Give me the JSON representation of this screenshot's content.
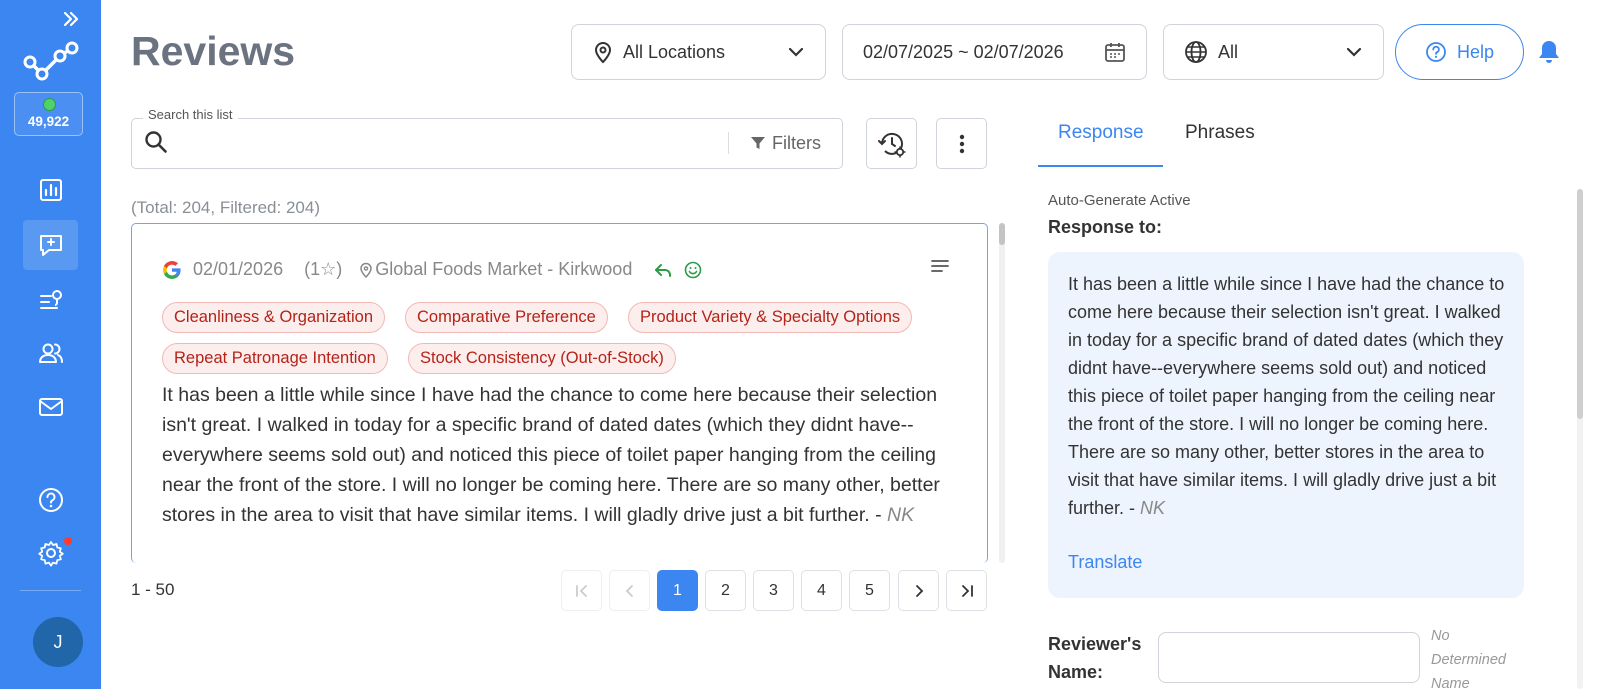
{
  "sidebar": {
    "credits": "49,922",
    "avatar_initial": "J",
    "items": [
      "dashboard-icon",
      "reviews-icon",
      "journey-icon",
      "users-icon",
      "mail-icon",
      "help-icon",
      "settings-icon"
    ]
  },
  "header": {
    "title": "Reviews",
    "location_select": "All Locations",
    "date_range": "02/07/2025 ~ 02/07/2026",
    "language_select": "All",
    "help_label": "Help"
  },
  "search": {
    "label": "Search this list",
    "value": "",
    "filters_label": "Filters"
  },
  "totals": "(Total: 204, Filtered: 204)",
  "review": {
    "date": "02/01/2026",
    "rating": "(1☆)",
    "location": "Global Foods Market - Kirkwood",
    "tags": [
      "Cleanliness & Organization",
      "Comparative Preference",
      "Product Variety & Specialty Options",
      "Repeat Patronage Intention",
      "Stock Consistency (Out-of-Stock)"
    ],
    "text": "It has been a little while since I have had the chance to come here because their selection isn't great. I walked in today for a specific brand of dated dates (which they didnt have--everywhere seems sold out) and noticed this piece of toilet paper hanging from the ceiling near the front of the store. I will no longer be coming here. There are so many other, better stores in the area to visit that have similar items. I will gladly drive just a bit further. - ",
    "author": "NK"
  },
  "pagination": {
    "range": "1 - 50",
    "pages": [
      "1",
      "2",
      "3",
      "4",
      "5"
    ],
    "current": "1"
  },
  "right_panel": {
    "tabs": [
      "Response",
      "Phrases"
    ],
    "active_tab": "Response",
    "auto_generate": "Auto-Generate Active",
    "response_to": "Response to:",
    "response_text": "It has been a little while since I have had the chance to come here because their selection isn't great. I walked in today for a specific brand of dated dates (which they didnt have--everywhere seems sold out) and noticed this piece of toilet paper hanging from the ceiling near the front of the store. I will no longer be coming here. There are so many other, better stores in the area to visit that have similar items. I will gladly drive just a bit further. - ",
    "response_author": "NK",
    "translate_label": "Translate",
    "reviewer_name_label_1": "Reviewer's",
    "reviewer_name_label_2": "Name:",
    "reviewer_name_value": "",
    "reviewer_name_note_1": "No",
    "reviewer_name_note_2": "Determined",
    "reviewer_name_note_3": "Name"
  },
  "colors": {
    "sidebar": "#3b86f0",
    "accent": "#3b86f0",
    "tag_bg": "#fdeeee",
    "tag_text": "#b42318"
  }
}
